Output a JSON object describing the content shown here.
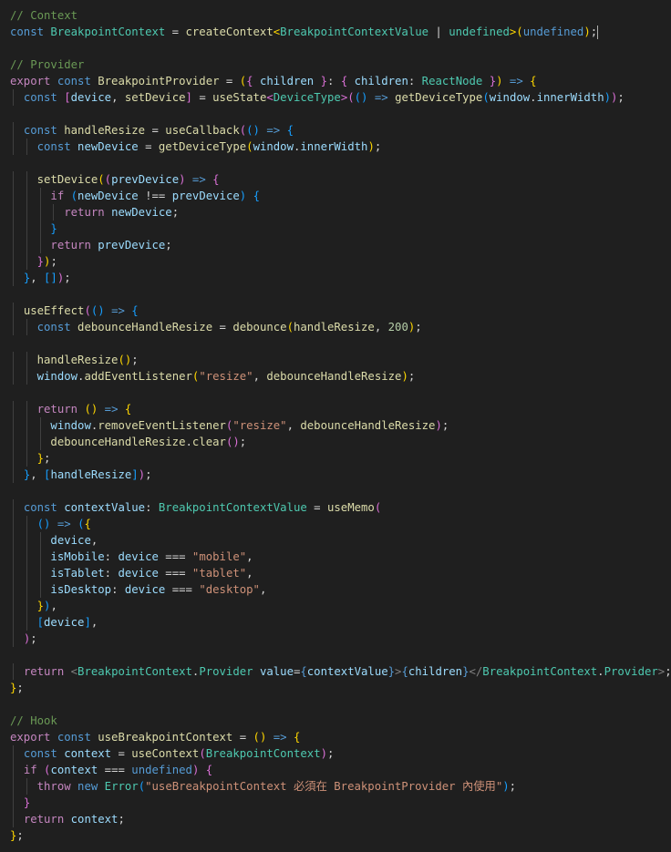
{
  "editor": {
    "lines": [
      [
        [
          "cm",
          "// Context"
        ]
      ],
      [
        [
          "kw",
          "const "
        ],
        [
          "ty",
          "BreakpointContext"
        ],
        [
          "op",
          " = "
        ],
        [
          "fn",
          "createContext"
        ],
        [
          "b1",
          "<"
        ],
        [
          "ty",
          "BreakpointContextValue"
        ],
        [
          "op",
          " | "
        ],
        [
          "ty",
          "undefined"
        ],
        [
          "b1",
          ">"
        ],
        [
          "b1",
          "("
        ],
        [
          "kw",
          "undefined"
        ],
        [
          "b1",
          ")"
        ],
        [
          "op",
          ";"
        ]
      ],
      [],
      [
        [
          "cm",
          "// Provider"
        ]
      ],
      [
        [
          "ctl",
          "export "
        ],
        [
          "kw",
          "const "
        ],
        [
          "fn",
          "BreakpointProvider"
        ],
        [
          "op",
          " = "
        ],
        [
          "b1",
          "("
        ],
        [
          "b2",
          "{"
        ],
        [
          "var",
          " children "
        ],
        [
          "b2",
          "}"
        ],
        [
          "op",
          ": "
        ],
        [
          "b2",
          "{"
        ],
        [
          "var",
          " children"
        ],
        [
          "op",
          ": "
        ],
        [
          "ty",
          "ReactNode"
        ],
        [
          "b2",
          " }"
        ],
        [
          "b1",
          ")"
        ],
        [
          "kw",
          " => "
        ],
        [
          "b1",
          "{"
        ]
      ],
      [
        [
          "pl",
          "  "
        ],
        [
          "kw",
          "const "
        ],
        [
          "b2",
          "["
        ],
        [
          "var",
          "device"
        ],
        [
          "op",
          ", "
        ],
        [
          "fn",
          "setDevice"
        ],
        [
          "b2",
          "]"
        ],
        [
          "op",
          " = "
        ],
        [
          "fn",
          "useState"
        ],
        [
          "b2",
          "<"
        ],
        [
          "ty",
          "DeviceType"
        ],
        [
          "b2",
          ">"
        ],
        [
          "b2",
          "("
        ],
        [
          "b3",
          "()"
        ],
        [
          "kw",
          " => "
        ],
        [
          "fn",
          "getDeviceType"
        ],
        [
          "b3",
          "("
        ],
        [
          "var",
          "window"
        ],
        [
          "op",
          "."
        ],
        [
          "var",
          "innerWidth"
        ],
        [
          "b3",
          ")"
        ],
        [
          "b2",
          ")"
        ],
        [
          "op",
          ";"
        ]
      ],
      [],
      [
        [
          "pl",
          "  "
        ],
        [
          "kw",
          "const "
        ],
        [
          "fn",
          "handleResize"
        ],
        [
          "op",
          " = "
        ],
        [
          "fn",
          "useCallback"
        ],
        [
          "b2",
          "("
        ],
        [
          "b3",
          "()"
        ],
        [
          "kw",
          " => "
        ],
        [
          "b3",
          "{"
        ]
      ],
      [
        [
          "pl",
          "    "
        ],
        [
          "kw",
          "const "
        ],
        [
          "var",
          "newDevice"
        ],
        [
          "op",
          " = "
        ],
        [
          "fn",
          "getDeviceType"
        ],
        [
          "b1",
          "("
        ],
        [
          "var",
          "window"
        ],
        [
          "op",
          "."
        ],
        [
          "var",
          "innerWidth"
        ],
        [
          "b1",
          ")"
        ],
        [
          "op",
          ";"
        ]
      ],
      [],
      [
        [
          "pl",
          "    "
        ],
        [
          "fn",
          "setDevice"
        ],
        [
          "b1",
          "("
        ],
        [
          "b2",
          "("
        ],
        [
          "var",
          "prevDevice"
        ],
        [
          "b2",
          ")"
        ],
        [
          "kw",
          " => "
        ],
        [
          "b2",
          "{"
        ]
      ],
      [
        [
          "pl",
          "      "
        ],
        [
          "ctl",
          "if "
        ],
        [
          "b3",
          "("
        ],
        [
          "var",
          "newDevice"
        ],
        [
          "op",
          " !== "
        ],
        [
          "var",
          "prevDevice"
        ],
        [
          "b3",
          ")"
        ],
        [
          "b3",
          " {"
        ]
      ],
      [
        [
          "pl",
          "        "
        ],
        [
          "ctl",
          "return "
        ],
        [
          "var",
          "newDevice"
        ],
        [
          "op",
          ";"
        ]
      ],
      [
        [
          "pl",
          "      "
        ],
        [
          "b3",
          "}"
        ]
      ],
      [
        [
          "pl",
          "      "
        ],
        [
          "ctl",
          "return "
        ],
        [
          "var",
          "prevDevice"
        ],
        [
          "op",
          ";"
        ]
      ],
      [
        [
          "pl",
          "    "
        ],
        [
          "b2",
          "}"
        ],
        [
          "b1",
          ")"
        ],
        [
          "op",
          ";"
        ]
      ],
      [
        [
          "pl",
          "  "
        ],
        [
          "b3",
          "}"
        ],
        [
          "op",
          ", "
        ],
        [
          "b3",
          "[]"
        ],
        [
          "b2",
          ")"
        ],
        [
          "op",
          ";"
        ]
      ],
      [],
      [
        [
          "pl",
          "  "
        ],
        [
          "fn",
          "useEffect"
        ],
        [
          "b2",
          "("
        ],
        [
          "b3",
          "()"
        ],
        [
          "kw",
          " => "
        ],
        [
          "b3",
          "{"
        ]
      ],
      [
        [
          "pl",
          "    "
        ],
        [
          "kw",
          "const "
        ],
        [
          "fn",
          "debounceHandleResize"
        ],
        [
          "op",
          " = "
        ],
        [
          "fn",
          "debounce"
        ],
        [
          "b1",
          "("
        ],
        [
          "fn",
          "handleResize"
        ],
        [
          "op",
          ", "
        ],
        [
          "num",
          "200"
        ],
        [
          "b1",
          ")"
        ],
        [
          "op",
          ";"
        ]
      ],
      [],
      [
        [
          "pl",
          "    "
        ],
        [
          "fn",
          "handleResize"
        ],
        [
          "b1",
          "()"
        ],
        [
          "op",
          ";"
        ]
      ],
      [
        [
          "pl",
          "    "
        ],
        [
          "var",
          "window"
        ],
        [
          "op",
          "."
        ],
        [
          "fn",
          "addEventListener"
        ],
        [
          "b1",
          "("
        ],
        [
          "str",
          "\"resize\""
        ],
        [
          "op",
          ", "
        ],
        [
          "fn",
          "debounceHandleResize"
        ],
        [
          "b1",
          ")"
        ],
        [
          "op",
          ";"
        ]
      ],
      [],
      [
        [
          "pl",
          "    "
        ],
        [
          "ctl",
          "return "
        ],
        [
          "b1",
          "()"
        ],
        [
          "kw",
          " => "
        ],
        [
          "b1",
          "{"
        ]
      ],
      [
        [
          "pl",
          "      "
        ],
        [
          "var",
          "window"
        ],
        [
          "op",
          "."
        ],
        [
          "fn",
          "removeEventListener"
        ],
        [
          "b2",
          "("
        ],
        [
          "str",
          "\"resize\""
        ],
        [
          "op",
          ", "
        ],
        [
          "fn",
          "debounceHandleResize"
        ],
        [
          "b2",
          ")"
        ],
        [
          "op",
          ";"
        ]
      ],
      [
        [
          "pl",
          "      "
        ],
        [
          "fn",
          "debounceHandleResize"
        ],
        [
          "op",
          "."
        ],
        [
          "fn",
          "clear"
        ],
        [
          "b2",
          "()"
        ],
        [
          "op",
          ";"
        ]
      ],
      [
        [
          "pl",
          "    "
        ],
        [
          "b1",
          "}"
        ],
        [
          "op",
          ";"
        ]
      ],
      [
        [
          "pl",
          "  "
        ],
        [
          "b3",
          "}"
        ],
        [
          "op",
          ", "
        ],
        [
          "b3",
          "["
        ],
        [
          "var",
          "handleResize"
        ],
        [
          "b3",
          "]"
        ],
        [
          "b2",
          ")"
        ],
        [
          "op",
          ";"
        ]
      ],
      [],
      [
        [
          "pl",
          "  "
        ],
        [
          "kw",
          "const "
        ],
        [
          "var",
          "contextValue"
        ],
        [
          "op",
          ": "
        ],
        [
          "ty",
          "BreakpointContextValue"
        ],
        [
          "op",
          " = "
        ],
        [
          "fn",
          "useMemo"
        ],
        [
          "b2",
          "("
        ]
      ],
      [
        [
          "pl",
          "    "
        ],
        [
          "b3",
          "()"
        ],
        [
          "kw",
          " => "
        ],
        [
          "b3",
          "("
        ],
        [
          "b1",
          "{"
        ]
      ],
      [
        [
          "pl",
          "      "
        ],
        [
          "var",
          "device"
        ],
        [
          "op",
          ","
        ]
      ],
      [
        [
          "pl",
          "      "
        ],
        [
          "var",
          "isMobile"
        ],
        [
          "op",
          ": "
        ],
        [
          "var",
          "device"
        ],
        [
          "op",
          " === "
        ],
        [
          "str",
          "\"mobile\""
        ],
        [
          "op",
          ","
        ]
      ],
      [
        [
          "pl",
          "      "
        ],
        [
          "var",
          "isTablet"
        ],
        [
          "op",
          ": "
        ],
        [
          "var",
          "device"
        ],
        [
          "op",
          " === "
        ],
        [
          "str",
          "\"tablet\""
        ],
        [
          "op",
          ","
        ]
      ],
      [
        [
          "pl",
          "      "
        ],
        [
          "var",
          "isDesktop"
        ],
        [
          "op",
          ": "
        ],
        [
          "var",
          "device"
        ],
        [
          "op",
          " === "
        ],
        [
          "str",
          "\"desktop\""
        ],
        [
          "op",
          ","
        ]
      ],
      [
        [
          "pl",
          "    "
        ],
        [
          "b1",
          "}"
        ],
        [
          "b3",
          ")"
        ],
        [
          "op",
          ","
        ]
      ],
      [
        [
          "pl",
          "    "
        ],
        [
          "b3",
          "["
        ],
        [
          "var",
          "device"
        ],
        [
          "b3",
          "]"
        ],
        [
          "op",
          ","
        ]
      ],
      [
        [
          "pl",
          "  "
        ],
        [
          "b2",
          ")"
        ],
        [
          "op",
          ";"
        ]
      ],
      [],
      [
        [
          "pl",
          "  "
        ],
        [
          "ctl",
          "return "
        ],
        [
          "tag",
          "<"
        ],
        [
          "ty",
          "BreakpointContext"
        ],
        [
          "op",
          "."
        ],
        [
          "ty",
          "Provider"
        ],
        [
          "var",
          " value"
        ],
        [
          "op",
          "="
        ],
        [
          "kw",
          "{"
        ],
        [
          "var",
          "contextValue"
        ],
        [
          "kw",
          "}"
        ],
        [
          "tag",
          ">"
        ],
        [
          "kw",
          "{"
        ],
        [
          "var",
          "children"
        ],
        [
          "kw",
          "}"
        ],
        [
          "tag",
          "</"
        ],
        [
          "ty",
          "BreakpointContext"
        ],
        [
          "op",
          "."
        ],
        [
          "ty",
          "Provider"
        ],
        [
          "tag",
          ">"
        ],
        [
          "op",
          ";"
        ]
      ],
      [
        [
          "b1",
          "}"
        ],
        [
          "op",
          ";"
        ]
      ],
      [],
      [
        [
          "cm",
          "// Hook"
        ]
      ],
      [
        [
          "ctl",
          "export "
        ],
        [
          "kw",
          "const "
        ],
        [
          "fn",
          "useBreakpointContext"
        ],
        [
          "op",
          " = "
        ],
        [
          "b1",
          "()"
        ],
        [
          "kw",
          " => "
        ],
        [
          "b1",
          "{"
        ]
      ],
      [
        [
          "pl",
          "  "
        ],
        [
          "kw",
          "const "
        ],
        [
          "var",
          "context"
        ],
        [
          "op",
          " = "
        ],
        [
          "fn",
          "useContext"
        ],
        [
          "b2",
          "("
        ],
        [
          "ty",
          "BreakpointContext"
        ],
        [
          "b2",
          ")"
        ],
        [
          "op",
          ";"
        ]
      ],
      [
        [
          "pl",
          "  "
        ],
        [
          "ctl",
          "if "
        ],
        [
          "b2",
          "("
        ],
        [
          "var",
          "context"
        ],
        [
          "op",
          " === "
        ],
        [
          "kw",
          "undefined"
        ],
        [
          "b2",
          ")"
        ],
        [
          "b2",
          " {"
        ]
      ],
      [
        [
          "pl",
          "    "
        ],
        [
          "ctl",
          "throw "
        ],
        [
          "kw",
          "new "
        ],
        [
          "ty",
          "Error"
        ],
        [
          "b3",
          "("
        ],
        [
          "str",
          "\"useBreakpointContext 必須在 BreakpointProvider 內使用\""
        ],
        [
          "b3",
          ")"
        ],
        [
          "op",
          ";"
        ]
      ],
      [
        [
          "pl",
          "  "
        ],
        [
          "b2",
          "}"
        ]
      ],
      [
        [
          "pl",
          "  "
        ],
        [
          "ctl",
          "return "
        ],
        [
          "var",
          "context"
        ],
        [
          "op",
          ";"
        ]
      ],
      [
        [
          "b1",
          "}"
        ],
        [
          "op",
          ";"
        ]
      ]
    ]
  }
}
